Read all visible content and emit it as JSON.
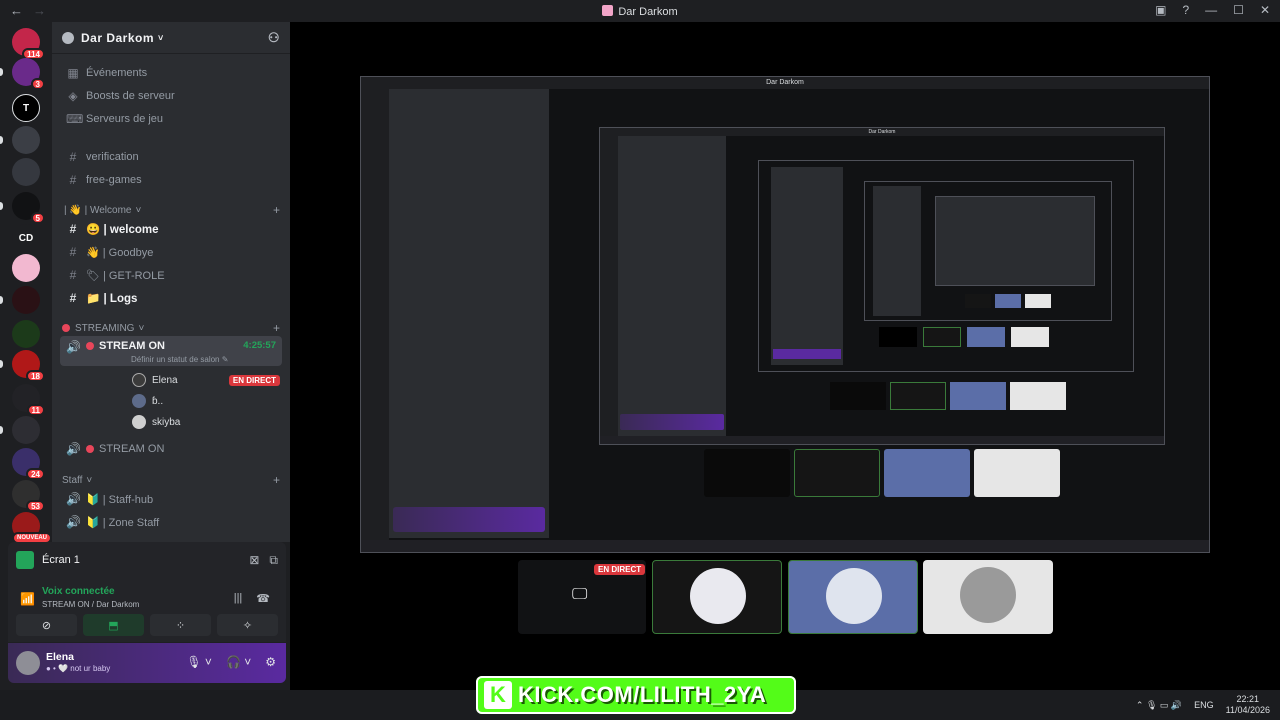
{
  "window": {
    "title": "Dar Darkom",
    "nav_back": "←",
    "nav_forward": "→",
    "ctrl_inbox": "▣",
    "ctrl_help": "?",
    "ctrl_min": "—",
    "ctrl_max": "☐",
    "ctrl_close": "✕"
  },
  "rail": {
    "servers": [
      {
        "label": "",
        "badge": "114",
        "color": "#c3264a"
      },
      {
        "label": "",
        "badge": "3",
        "color": "#6a2a8a"
      },
      {
        "label": "T",
        "badge": "",
        "color": "#000000"
      },
      {
        "label": "",
        "badge": "",
        "color": "#3b3e45"
      },
      {
        "label": "",
        "badge": "",
        "color": "#35383f"
      },
      {
        "label": "",
        "badge": "5",
        "color": "#111214"
      },
      {
        "label": "CD",
        "badge": "",
        "color": "#1e1f22"
      },
      {
        "label": "",
        "badge": "",
        "color": "#f2b8d0"
      },
      {
        "label": "",
        "badge": "",
        "color": "#2a1115"
      },
      {
        "label": "",
        "badge": "",
        "color": "#1c3a1a"
      },
      {
        "label": "",
        "badge": "18",
        "color": "#b01818"
      },
      {
        "label": "",
        "badge": "11",
        "color": "#222226"
      },
      {
        "label": "",
        "badge": "",
        "color": "#2d2d33"
      },
      {
        "label": "",
        "badge": "24",
        "color": "#3a2f6a"
      },
      {
        "label": "",
        "badge": "53",
        "color": "#2f2f2f"
      },
      {
        "label": "",
        "badge": "NOUVEAU",
        "color": "#9a1a1a"
      }
    ]
  },
  "sidebar": {
    "server_name": "Dar Darkom",
    "menu": [
      {
        "icon": "calendar-icon",
        "glyph": "▦",
        "label": "Événements"
      },
      {
        "icon": "boost-icon",
        "glyph": "◈",
        "label": "Boosts de serveur"
      },
      {
        "icon": "gamepad-icon",
        "glyph": "⌨",
        "label": "Serveurs de jeu"
      }
    ],
    "channels_top": [
      {
        "label": "verification"
      },
      {
        "label": "free-games"
      }
    ],
    "category_welcome": "| 👋 | Welcome",
    "welcome_channels": [
      {
        "label": "😀 | welcome",
        "bright": true
      },
      {
        "label": "👋 | Goodbye",
        "bright": false
      },
      {
        "label": "🏷 | GET-ROLE",
        "bright": false
      },
      {
        "label": "📁 | Logs",
        "bright": true
      }
    ],
    "category_streaming": "STREAMING",
    "stream_channel": "STREAM ON",
    "stream_time": "4:25:57",
    "stream_status": "Définir un statut de salon ✎",
    "members": [
      {
        "name": "Elena",
        "live": "EN DIRECT",
        "color": "#3b3b3b"
      },
      {
        "name": "ɓ..",
        "live": "",
        "color": "#5d6b8a"
      },
      {
        "name": "skiyba",
        "live": "",
        "color": "#cfcfcf"
      }
    ],
    "stream_channel_2": "STREAM ON",
    "category_staff": "Staff",
    "staff_channels": [
      {
        "label": "🔰 | Staff-hub"
      },
      {
        "label": "🔰 | Zone Staff"
      }
    ]
  },
  "voice": {
    "screen_label": "Écran 1",
    "connected": "Voix connectée",
    "location": "STREAM ON / Dar Darkom",
    "buttons": [
      "⊘",
      "⬒",
      "⁘",
      "✧"
    ]
  },
  "user": {
    "name": "Elena",
    "status": "● • 🤍 not ur baby",
    "mic": "🎙 ˅",
    "headset": "🎧 ˅",
    "settings": "⚙"
  },
  "stream": {
    "tile_live": "EN DIRECT",
    "tiles": [
      {
        "kind": "screen",
        "bg": "#111214"
      },
      {
        "kind": "avatar",
        "bg": "#151515",
        "circle": "#e9e9ef"
      },
      {
        "kind": "avatar",
        "bg": "#5b6ea8",
        "circle": "#dfe4ee"
      },
      {
        "kind": "avatar",
        "bg": "#e6e6e6",
        "circle": "#9a9a9a"
      }
    ]
  },
  "overlay": {
    "kick_text": "KICK.COM/LILITH_2YA",
    "kick_logo": "K"
  },
  "taskbar": {
    "lang": "ENG",
    "time": "22:21",
    "date": "11/04/2026",
    "tray_icons": "⌃  🎙  ▭  🔊"
  }
}
